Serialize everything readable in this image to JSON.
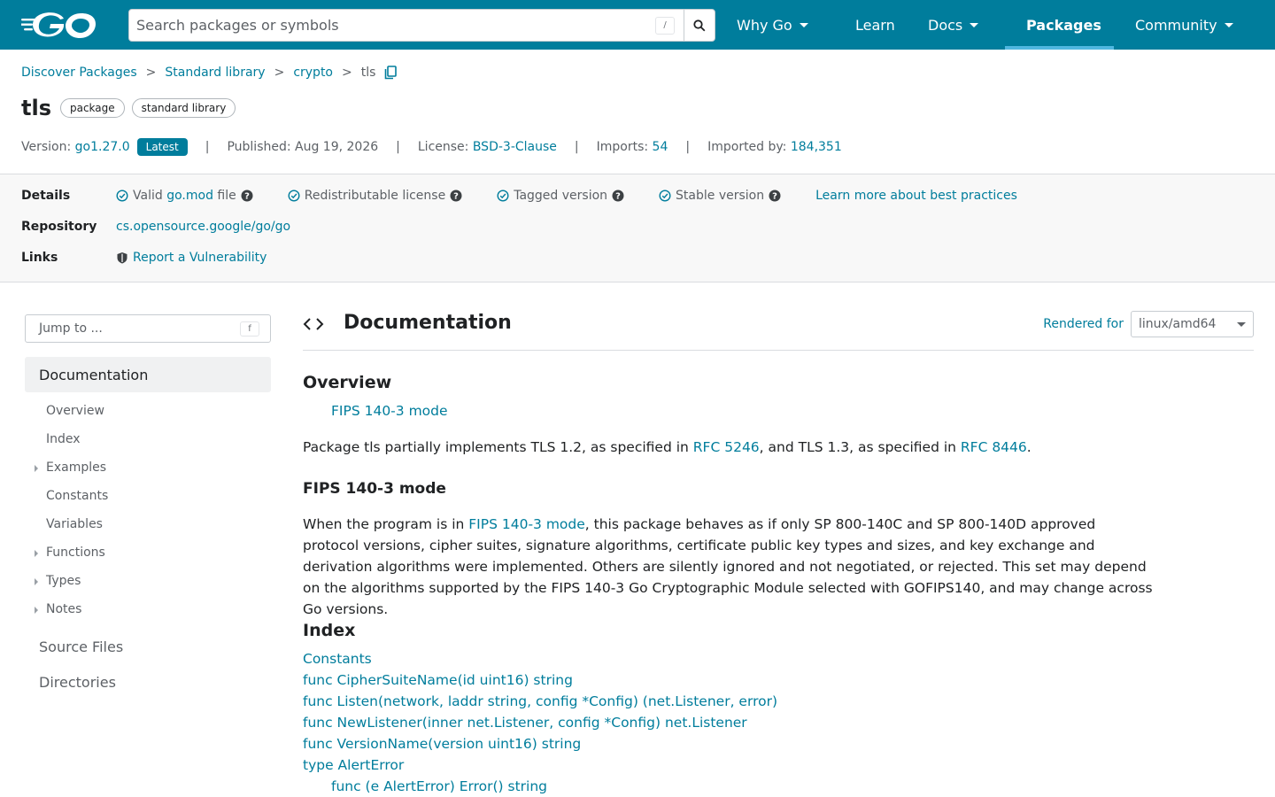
{
  "header": {
    "search_placeholder": "Search packages or symbols",
    "slash_key": "/",
    "nav": [
      {
        "label": "Why Go",
        "dropdown": true
      },
      {
        "label": "Learn",
        "dropdown": false
      },
      {
        "label": "Docs",
        "dropdown": true
      },
      {
        "label": "Packages",
        "dropdown": false,
        "active": true
      },
      {
        "label": "Community",
        "dropdown": true
      }
    ]
  },
  "breadcrumb": {
    "items": [
      "Discover Packages",
      "Standard library",
      "crypto"
    ],
    "current": "tls",
    "separator": ">"
  },
  "package": {
    "name": "tls",
    "chips": [
      "package",
      "standard library"
    ]
  },
  "meta": {
    "version_label": "Version:",
    "version": "go1.27.0",
    "latest_badge": "Latest",
    "published_label": "Published: Aug 19, 2026",
    "license_label": "License:",
    "license": "BSD-3-Clause",
    "imports_label": "Imports:",
    "imports": "54",
    "imported_by_label": "Imported by:",
    "imported_by": "184,351",
    "separator": "|"
  },
  "details": {
    "details_label": "Details",
    "check_valid_pre": "Valid",
    "check_valid_link": "go.mod",
    "check_valid_post": "file",
    "check_license": "Redistributable license",
    "check_tagged": "Tagged version",
    "check_stable": "Stable version",
    "learn_more": "Learn more about best practices",
    "repository_label": "Repository",
    "repository": "cs.opensource.google/go/go",
    "links_label": "Links",
    "report": "Report a Vulnerability"
  },
  "sidebar": {
    "jump_placeholder": "Jump to ...",
    "jump_key": "f",
    "documentation": "Documentation",
    "sub": [
      "Overview",
      "Index",
      "Examples",
      "Constants",
      "Variables",
      "Functions",
      "Types",
      "Notes"
    ],
    "source_files": "Source Files",
    "directories": "Directories"
  },
  "main": {
    "title": "Documentation",
    "rendered_for": "Rendered for",
    "platform": "linux/amd64",
    "overview_heading": "Overview",
    "overview_link": "FIPS 140-3 mode",
    "intro_pre": "Package tls partially implements TLS 1.2, as specified in ",
    "rfc1": "RFC 5246",
    "intro_mid": ", and TLS 1.3, as specified in ",
    "rfc2": "RFC 8446",
    "intro_post": ".",
    "fips_heading": "FIPS 140-3 mode",
    "fips_pre": "When the program is in ",
    "fips_link": "FIPS 140-3 mode",
    "fips_post": ", this package behaves as if only SP 800-140C and SP 800-140D approved protocol versions, cipher suites, signature algorithms, certificate public key types and sizes, and key exchange and derivation algorithms were implemented. Others are silently ignored and not negotiated, or rejected. This set may depend on the algorithms supported by the FIPS 140-3 Go Cryptographic Module selected with GOFIPS140, and may change across Go versions.",
    "index_heading": "Index",
    "index": [
      "Constants",
      "func CipherSuiteName(id uint16) string",
      "func Listen(network, laddr string, config *Config) (net.Listener, error)",
      "func NewListener(inner net.Listener, config *Config) net.Listener",
      "func VersionName(version uint16) string",
      "type AlertError",
      "func (e AlertError) Error() string"
    ]
  }
}
